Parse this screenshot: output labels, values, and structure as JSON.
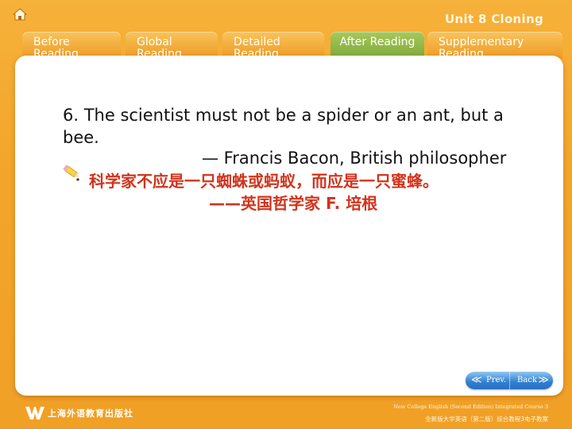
{
  "header": {
    "unit_title": "Unit 8 Cloning"
  },
  "tabs": [
    {
      "label": "Before\nReading",
      "active": false
    },
    {
      "label": "Global\nReading",
      "active": false
    },
    {
      "label": "Detailed\nReading",
      "active": false
    },
    {
      "label": "After Reading",
      "active": true
    },
    {
      "label": "Supplementary\nReading",
      "active": false
    }
  ],
  "content": {
    "quote": "6. The scientist must not be a spider or an ant, but a bee.",
    "attribution": "— Francis Bacon, British philosopher",
    "translation_line1": "科学家不应是一只蜘蛛或蚂蚁，而应是一只蜜蜂。",
    "translation_line2": "——英国哲学家 F. 培根"
  },
  "nav": {
    "prev_label": "Prev.",
    "back_label": "Back"
  },
  "footer": {
    "publisher": "上海外语教育出版社",
    "course_en": "New College English (Second Edition) Integrated Course 3",
    "course_cn": "全新版大学英语（第二版）综合教程3电子教案"
  },
  "colors": {
    "background": "#f3a52b",
    "active_tab": "#8ab545",
    "translation_text": "#d2331b",
    "nav_button": "#2f7fd0"
  }
}
